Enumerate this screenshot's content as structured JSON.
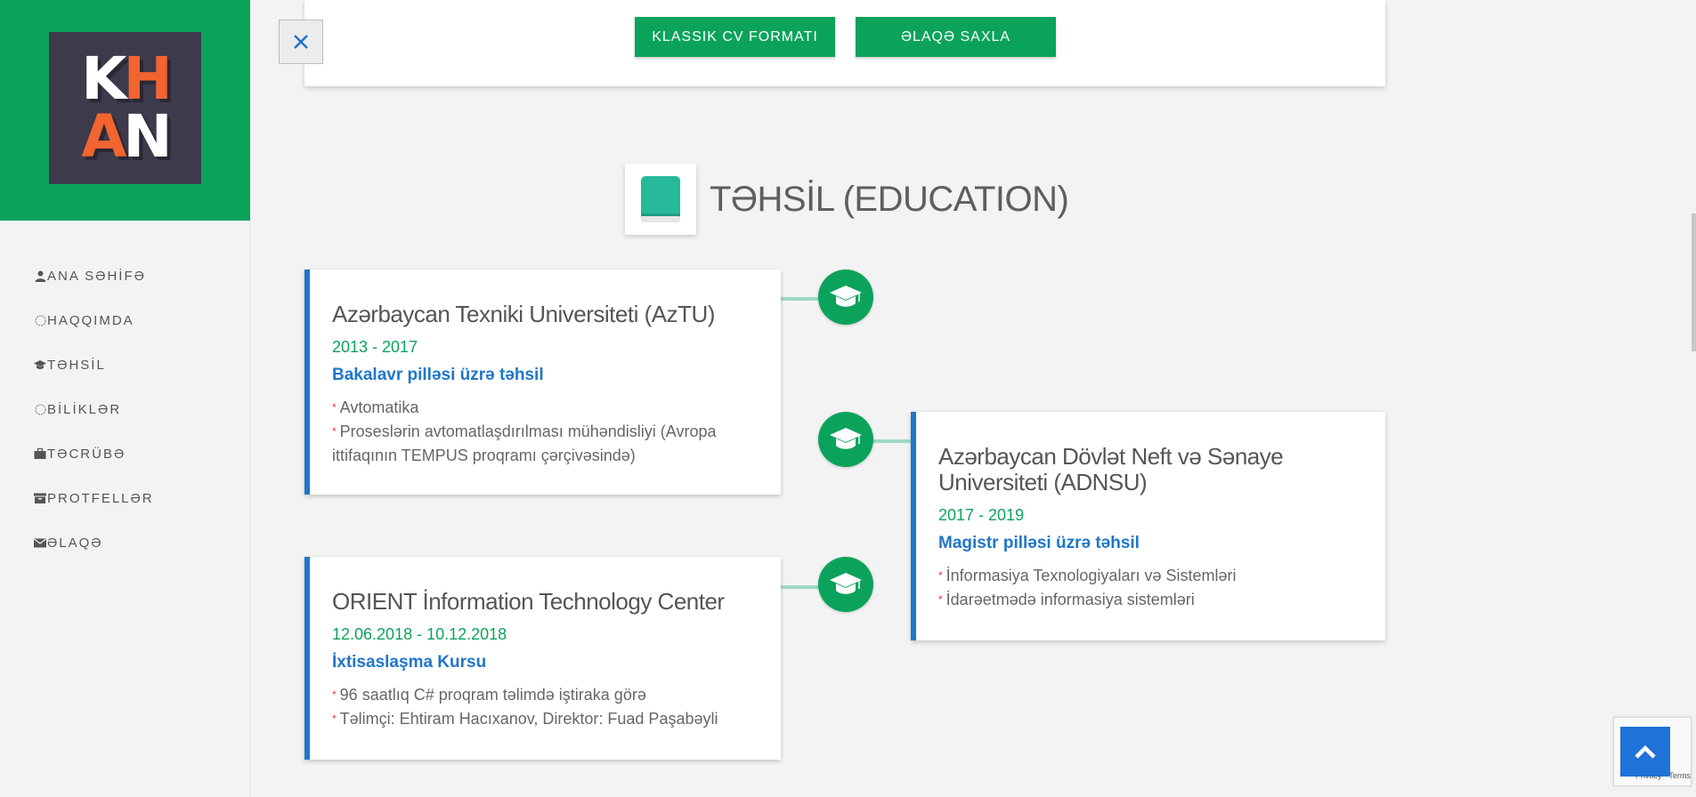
{
  "sidebar": {
    "logo": {
      "line1_a": "K",
      "line1_b": "H",
      "line2_a": "A",
      "line2_b": "N"
    },
    "items": [
      {
        "label": "ANA SƏHİFƏ",
        "icon": "user-icon"
      },
      {
        "label": "HAQQIMDA",
        "icon": "circle-icon"
      },
      {
        "label": "TƏHSİL",
        "icon": "graduation-cap-icon"
      },
      {
        "label": "BİLİKLƏR",
        "icon": "circle-icon"
      },
      {
        "label": "TƏCRÜBƏ",
        "icon": "briefcase-icon"
      },
      {
        "label": "PROTFELLƏR",
        "icon": "archive-icon"
      },
      {
        "label": "ƏLAQƏ",
        "icon": "envelope-icon"
      }
    ]
  },
  "top_card": {
    "cv_button": "KLASSIK CV FORMATI",
    "contact_button": "ƏLAQƏ SAXLA"
  },
  "section": {
    "title": "TƏHSİL (EDUCATION)"
  },
  "education": [
    {
      "title": "Azərbaycan Texniki Universiteti (AzTU)",
      "years": "2013 - 2017",
      "degree": "Bakalavr pilləsi üzrə təhsil",
      "items": [
        "Avtomatika",
        "Proseslərin avtomatlaşdırılması mühəndisliyi (Avropa ittifaqının TEMPUS proqramı çərçivəsində)"
      ]
    },
    {
      "title": "Azərbaycan Dövlət Neft və Sənaye Universiteti (ADNSU)",
      "years": "2017 - 2019",
      "degree": "Magistr pilləsi üzrə təhsil",
      "items": [
        "İnformasiya Texnologiyaları və Sistemləri",
        "İdarəetmədə informasiya sistemləri"
      ]
    },
    {
      "title": "ORIENT İnformation Technology Center",
      "years": "12.06.2018 - 10.12.2018",
      "degree": "İxtisaslaşma Kursu",
      "items": [
        "96 saatlıq C# proqram təlimdə iştiraka görə",
        "Təlimçi: Ehtiram Hacıxanov, Direktor: Fuad Paşabəyli"
      ]
    }
  ],
  "captcha": {
    "text": "Privacy - Terms"
  },
  "colors": {
    "green": "#0ba35c",
    "blue": "#2076c9",
    "logo_bg": "#3d3a4b",
    "logo_orange": "#f26430"
  }
}
